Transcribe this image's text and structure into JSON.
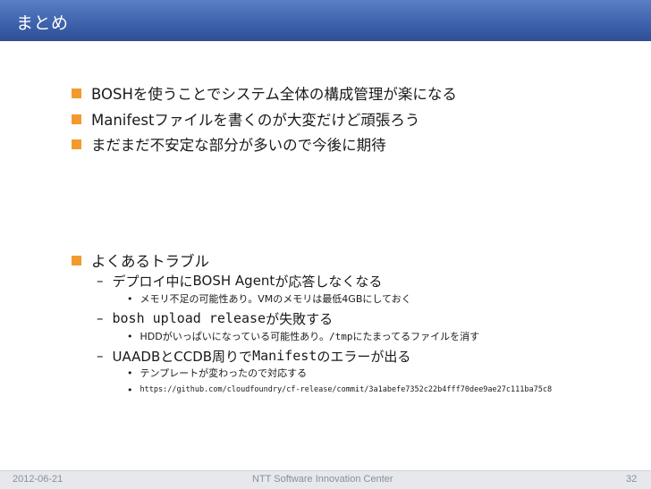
{
  "slide": {
    "title": "まとめ",
    "summary_bullets": [
      "BOSHを使うことでシステム全体の構成管理が楽になる",
      "Manifestファイルを書くのが大変だけど頑張ろう",
      "まだまだ不安定な部分が多いので今後に期待"
    ],
    "trouble": {
      "heading": "よくあるトラブル",
      "items": [
        {
          "prefix": "デプロイ中に",
          "code": "BOSH Agent",
          "suffix": "が応答しなくなる",
          "sub_parts": [
            "メモリ不足の可能性あり。VMのメモリは最低4GBにしておく"
          ]
        },
        {
          "prefix": "",
          "code": "bosh upload release",
          "suffix": "が失敗する",
          "sub_parts": [
            "HDDがいっぱいになっている可能性あり。",
            "/tmp",
            "にたまってるファイルを消す"
          ]
        },
        {
          "prefix": "UAADBとCCDB周りで",
          "code": "Manifest",
          "suffix": "のエラーが出る",
          "subs": [
            "テンプレートが変わったので対応する",
            "https://github.com/cloudfoundry/cf-release/commit/3a1abefe7352c22b4fff70dee9ae27c111ba75c8"
          ]
        }
      ]
    },
    "footer": {
      "date": "2012-06-21",
      "org": "NTT Software Innovation Center",
      "page": "32"
    }
  },
  "colors": {
    "title_bar": "#3f63ad",
    "bullet": "#f29a2e",
    "footer_bg": "#e6e8ec"
  }
}
